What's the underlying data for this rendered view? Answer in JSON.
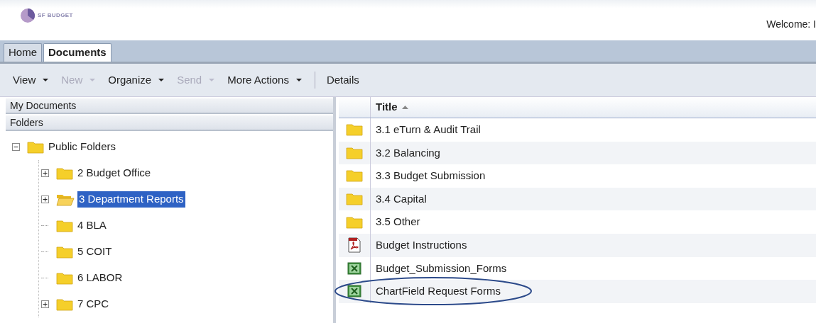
{
  "header": {
    "logo_text": "SF BUDGET",
    "welcome": "Welcome: I"
  },
  "tabs": [
    {
      "label": "Home",
      "selected": false
    },
    {
      "label": "Documents",
      "selected": true
    }
  ],
  "toolbar": [
    {
      "label": "View",
      "disabled": false,
      "kind": "menu"
    },
    {
      "label": "New",
      "disabled": true,
      "kind": "menu"
    },
    {
      "label": "Organize",
      "disabled": false,
      "kind": "menu"
    },
    {
      "label": "Send",
      "disabled": true,
      "kind": "menu"
    },
    {
      "label": "More Actions",
      "disabled": false,
      "kind": "menu"
    },
    {
      "label": "Details",
      "disabled": false,
      "kind": "button"
    }
  ],
  "sidebar": {
    "sections": [
      "My Documents",
      "Folders"
    ],
    "tree": [
      {
        "label": "Public Folders",
        "expandable": true,
        "expanded": true,
        "selected": false,
        "children": [
          {
            "label": "2 Budget Office",
            "expandable": true,
            "expanded": false,
            "selected": false
          },
          {
            "label": "3 Department Reports",
            "expandable": true,
            "expanded": false,
            "selected": true
          },
          {
            "label": "4 BLA",
            "expandable": false,
            "expanded": false,
            "selected": false
          },
          {
            "label": "5 COIT",
            "expandable": false,
            "expanded": false,
            "selected": false
          },
          {
            "label": "6 LABOR",
            "expandable": false,
            "expanded": false,
            "selected": false
          },
          {
            "label": "7 CPC",
            "expandable": true,
            "expanded": false,
            "selected": false
          }
        ]
      }
    ]
  },
  "table": {
    "columns": [
      "Title"
    ],
    "rows": [
      {
        "kind": "folder",
        "title": "3.1 eTurn & Audit Trail",
        "circled": false
      },
      {
        "kind": "folder",
        "title": "3.2 Balancing",
        "circled": false
      },
      {
        "kind": "folder",
        "title": "3.3 Budget Submission",
        "circled": false
      },
      {
        "kind": "folder",
        "title": "3.4 Capital",
        "circled": false
      },
      {
        "kind": "folder",
        "title": "3.5 Other",
        "circled": false
      },
      {
        "kind": "pdf",
        "title": "Budget Instructions",
        "circled": false
      },
      {
        "kind": "excel",
        "title": "Budget_Submission_Forms",
        "circled": false
      },
      {
        "kind": "excel",
        "title": "ChartField Request Forms",
        "circled": true
      }
    ]
  }
}
